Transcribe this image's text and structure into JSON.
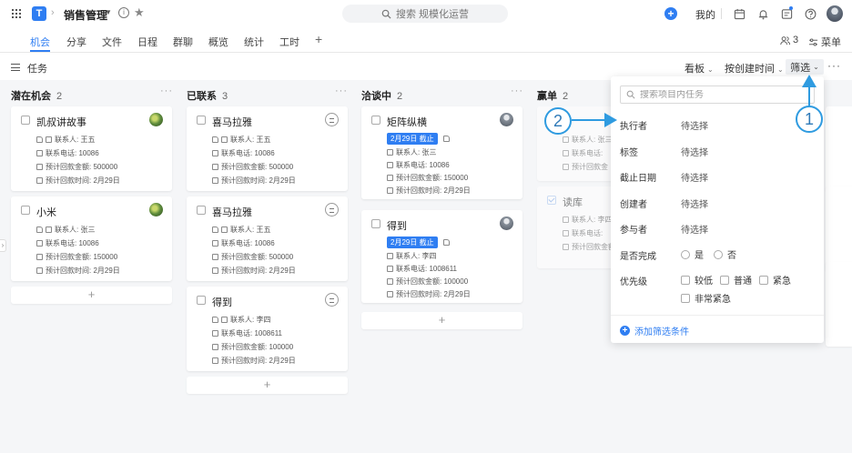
{
  "header": {
    "logo_char": "T",
    "breadcrumb_sep": "›",
    "project_title": "销售管理",
    "search_placeholder": "搜索 规模化运营",
    "my_label": "我的",
    "icons": [
      "apps-grid-icon",
      "info-icon",
      "star-icon",
      "search-icon",
      "add-icon",
      "calendar-icon",
      "bell-icon",
      "inbox-icon",
      "help-icon",
      "avatar"
    ]
  },
  "tabs": {
    "items": [
      "机会",
      "分享",
      "文件",
      "日程",
      "群聊",
      "概览",
      "统计",
      "工时"
    ],
    "active": "机会",
    "members_count": "3",
    "menu_label": "菜单"
  },
  "section": {
    "title": "任务",
    "view_label": "看板",
    "sort_label": "按创建时间",
    "filter_label": "筛选"
  },
  "columns": [
    {
      "title": "潜在机会",
      "count": "2",
      "cards": [
        {
          "title": "凯叔讲故事",
          "contact": "联系人: 王五",
          "phone": "联系电话: 10086",
          "amount": "预计回款金额: 500000",
          "date": "预计回款时间: 2月29日"
        },
        {
          "title": "小米",
          "contact": "联系人: 张三",
          "phone": "联系电话: 10086",
          "amount": "预计回款金额: 150000",
          "date": "预计回款时间: 2月29日"
        }
      ]
    },
    {
      "title": "已联系",
      "count": "3",
      "cards": [
        {
          "title": "喜马拉雅",
          "contact": "联系人: 王五",
          "phone": "联系电话: 10086",
          "amount": "预计回款金额: 500000",
          "date": "预计回款时间: 2月29日"
        },
        {
          "title": "喜马拉雅",
          "contact": "联系人: 王五",
          "phone": "联系电话: 10086",
          "amount": "预计回款金额: 500000",
          "date": "预计回款时间: 2月29日"
        },
        {
          "title": "得到",
          "contact": "联系人: 李四",
          "phone": "联系电话: 1008611",
          "amount": "预计回款金额: 100000",
          "date": "预计回款时间: 2月29日"
        }
      ]
    },
    {
      "title": "洽谈中",
      "count": "2",
      "cards": [
        {
          "title": "矩阵纵横",
          "due": "2月29日 截止",
          "contact": "联系人: 张三",
          "phone": "联系电话: 10086",
          "amount": "预计回款金额: 150000",
          "date": "预计回款时间: 2月29日"
        },
        {
          "title": "得到",
          "due": "2月29日 截止",
          "contact": "联系人: 李四",
          "phone": "联系电话: 1008611",
          "amount": "预计回款金额: 100000",
          "date": "预计回款时间: 2月29日"
        }
      ]
    },
    {
      "title": "赢单",
      "count": "2",
      "cards": [
        {
          "contact": "联系人: 张三",
          "phone": "联系电话:",
          "amount": "预计回款金"
        },
        {
          "title": "读库",
          "contact": "联系人: 李四",
          "phone": "联系电话:",
          "amount": "预计回款金额"
        }
      ]
    }
  ],
  "add_symbol": "+",
  "filter_panel": {
    "search_placeholder": "搜索项目内任务",
    "fields": [
      {
        "label": "执行者",
        "value": "待选择"
      },
      {
        "label": "标签",
        "value": "待选择"
      },
      {
        "label": "截止日期",
        "value": "待选择"
      },
      {
        "label": "创建者",
        "value": "待选择"
      },
      {
        "label": "参与者",
        "value": "待选择"
      }
    ],
    "done_label": "是否完成",
    "done_options": [
      "是",
      "否"
    ],
    "priority_label": "优先级",
    "priority_options": [
      "较低",
      "普通",
      "紧急",
      "非常紧急"
    ],
    "add_condition": "添加筛选条件"
  },
  "annotations": [
    "1",
    "2"
  ],
  "colors": {
    "accent": "#2f7ef2",
    "callout": "#2f9be0",
    "board_bg": "#f5f6f8"
  }
}
